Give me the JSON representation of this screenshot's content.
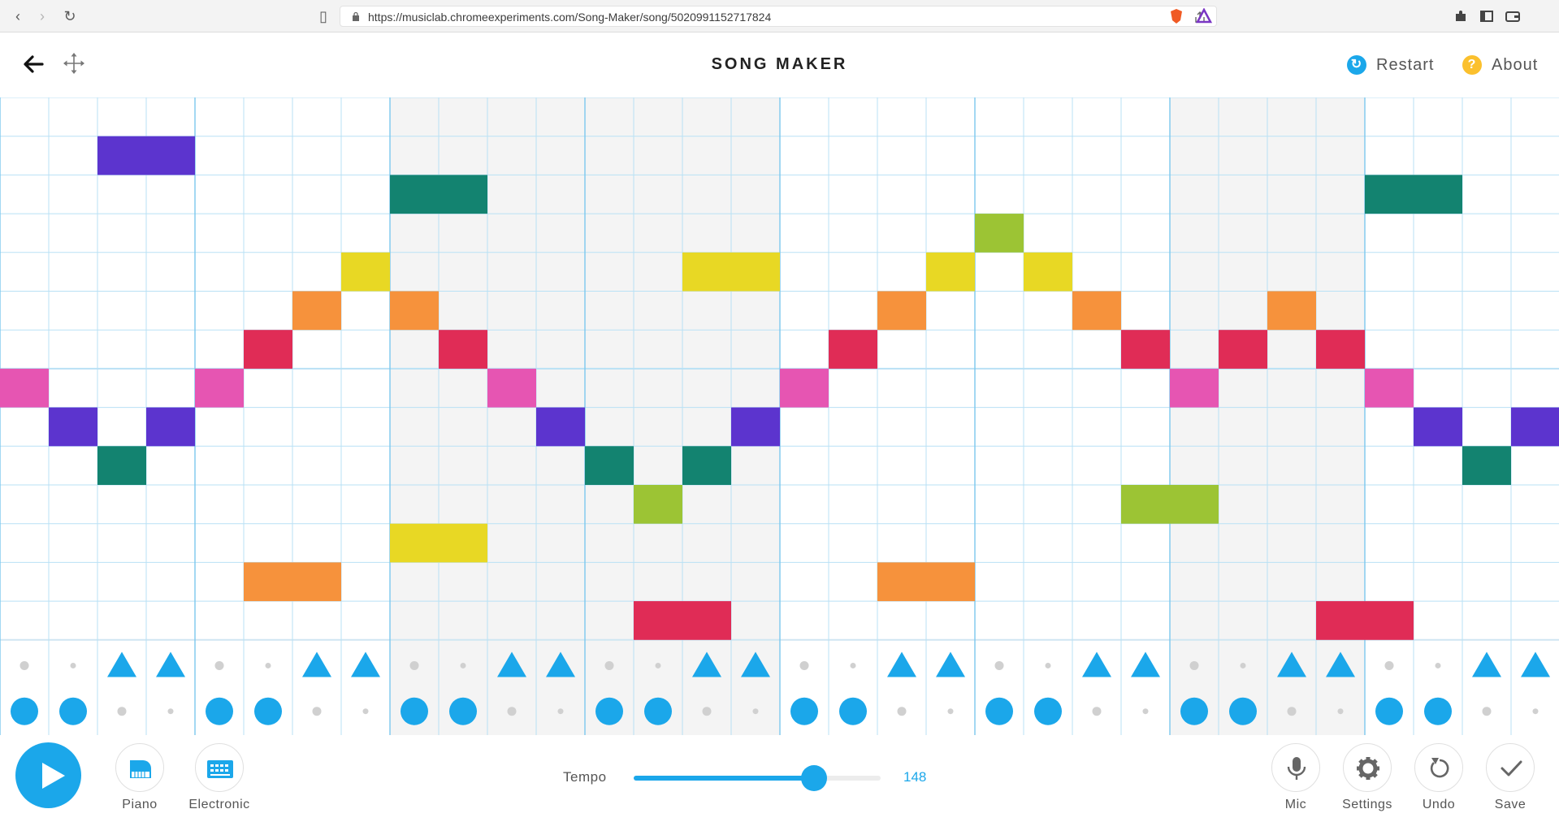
{
  "browser": {
    "url": "https://musiclab.chromeexperiments.com/Song-Maker/song/5020991152717824"
  },
  "header": {
    "title": "SONG MAKER",
    "restart_label": "Restart",
    "about_label": "About",
    "about_glyph": "?"
  },
  "grid": {
    "columns": 32,
    "melody_rows": 14,
    "bar_columns": 4,
    "shaded_bars": [
      2,
      3,
      6
    ],
    "row_colors": [
      "#5c34ce",
      "#5c34ce",
      "#138370",
      "#9cc434",
      "#e8d824",
      "#f6923c",
      "#e02c56",
      "#e655b2",
      "#5c34ce",
      "#138370",
      "#9cc434",
      "#e8d824",
      "#f6923c",
      "#e02c56"
    ],
    "notes": [
      {
        "row": 1,
        "col": 2
      },
      {
        "row": 1,
        "col": 3
      },
      {
        "row": 2,
        "col": 8
      },
      {
        "row": 2,
        "col": 9
      },
      {
        "row": 2,
        "col": 28
      },
      {
        "row": 2,
        "col": 29
      },
      {
        "row": 3,
        "col": 20
      },
      {
        "row": 4,
        "col": 7
      },
      {
        "row": 4,
        "col": 14
      },
      {
        "row": 4,
        "col": 15
      },
      {
        "row": 4,
        "col": 19
      },
      {
        "row": 4,
        "col": 21
      },
      {
        "row": 5,
        "col": 6
      },
      {
        "row": 5,
        "col": 8
      },
      {
        "row": 5,
        "col": 18
      },
      {
        "row": 5,
        "col": 22
      },
      {
        "row": 5,
        "col": 26
      },
      {
        "row": 6,
        "col": 5
      },
      {
        "row": 6,
        "col": 9
      },
      {
        "row": 6,
        "col": 17
      },
      {
        "row": 6,
        "col": 23
      },
      {
        "row": 6,
        "col": 25
      },
      {
        "row": 6,
        "col": 27
      },
      {
        "row": 7,
        "col": 0
      },
      {
        "row": 7,
        "col": 4
      },
      {
        "row": 7,
        "col": 10
      },
      {
        "row": 7,
        "col": 16
      },
      {
        "row": 7,
        "col": 24
      },
      {
        "row": 7,
        "col": 28
      },
      {
        "row": 8,
        "col": 1
      },
      {
        "row": 8,
        "col": 3
      },
      {
        "row": 8,
        "col": 11
      },
      {
        "row": 8,
        "col": 15
      },
      {
        "row": 8,
        "col": 29
      },
      {
        "row": 8,
        "col": 31
      },
      {
        "row": 9,
        "col": 2
      },
      {
        "row": 9,
        "col": 12
      },
      {
        "row": 9,
        "col": 14
      },
      {
        "row": 9,
        "col": 30
      },
      {
        "row": 10,
        "col": 13
      },
      {
        "row": 10,
        "col": 23
      },
      {
        "row": 10,
        "col": 24
      },
      {
        "row": 11,
        "col": 8
      },
      {
        "row": 11,
        "col": 9
      },
      {
        "row": 12,
        "col": 5
      },
      {
        "row": 12,
        "col": 6
      },
      {
        "row": 12,
        "col": 18
      },
      {
        "row": 12,
        "col": 19
      },
      {
        "row": 13,
        "col": 13
      },
      {
        "row": 13,
        "col": 14
      },
      {
        "row": 13,
        "col": 27
      },
      {
        "row": 13,
        "col": 28
      }
    ],
    "percussion": {
      "pattern_row1": "..TT",
      "pattern_row2": "CC..",
      "accent_color": "#1ba7ea",
      "dot_color": "#d0d0d0"
    }
  },
  "controls": {
    "instrument_1": "Piano",
    "instrument_2": "Electronic",
    "tempo_label": "Tempo",
    "tempo_value": "148",
    "tempo_fraction": 0.73,
    "mic_label": "Mic",
    "settings_label": "Settings",
    "undo_label": "Undo",
    "save_label": "Save"
  },
  "colors": {
    "accent": "#1ba7ea",
    "about_icon": "#fbc02d",
    "gridline": "#b9e1f5",
    "barline": "#7cc8ee",
    "shade": "#f4f4f4"
  }
}
